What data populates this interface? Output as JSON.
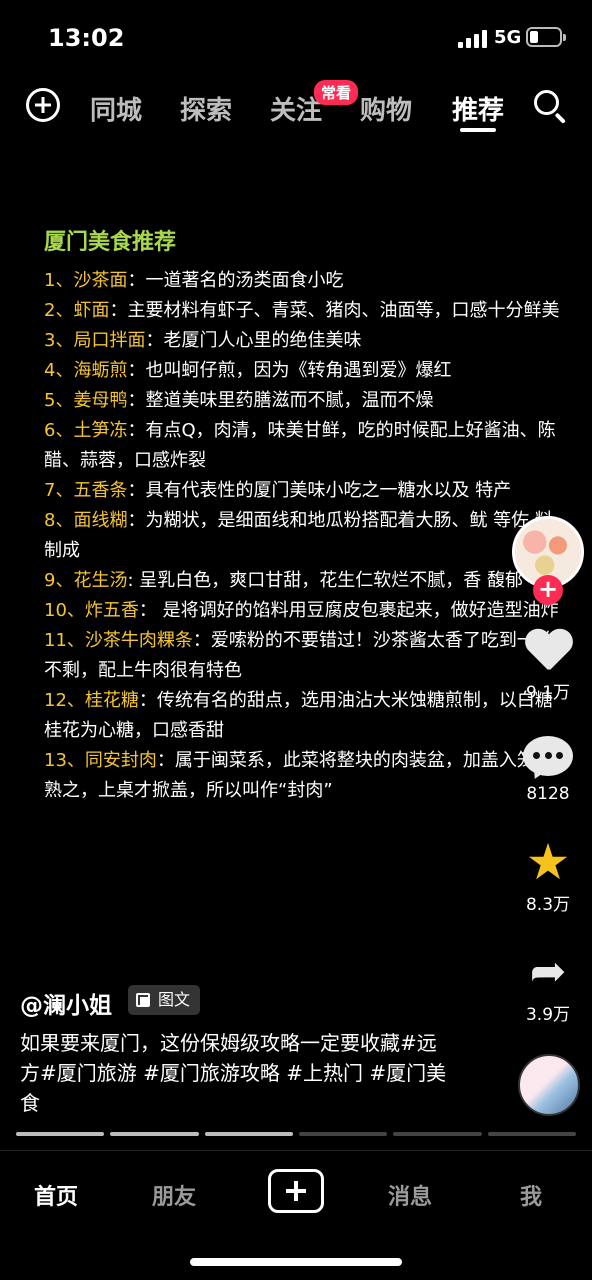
{
  "status_bar": {
    "time": "13:02",
    "network": "5G"
  },
  "top_nav": {
    "tabs": [
      "同城",
      "探索",
      "关注",
      "购物",
      "推荐"
    ],
    "badge": "常看",
    "active_tab": "推荐"
  },
  "post": {
    "title": "厦门美食推荐",
    "items": [
      {
        "num": "1、",
        "name": "沙茶面",
        "text": "：一道著名的汤类面食小吃"
      },
      {
        "num": "2、",
        "name": "虾面",
        "text": "：主要材料有虾子、青菜、猪肉、油面等，口感十分鲜美"
      },
      {
        "num": "3、",
        "name": "局口拌面",
        "text": "：老厦门人心里的绝佳美味"
      },
      {
        "num": "4、",
        "name": "海蛎煎",
        "text": "：也叫蚵仔煎，因为《转角遇到爱》爆红"
      },
      {
        "num": "5、",
        "name": "姜母鸭",
        "text": "：整道美味里药膳滋而不腻，温而不燥"
      },
      {
        "num": "6、",
        "name": "土笋冻",
        "text": "：有点Q，肉清，味美甘鲜，吃的时候配上好酱油、陈醋、蒜蓉，口感炸裂"
      },
      {
        "num": "7、",
        "name": "五香条",
        "text": "：具有代表性的厦门美味小吃之一糖水以及 特产"
      },
      {
        "num": "8、",
        "name": "面线糊",
        "text": "：为糊状，是细面线和地瓜粉搭配着大肠、鱿 等佐  料制成"
      },
      {
        "num": "9、",
        "name": "花生汤",
        "text": ": 呈乳白色，爽口甘甜，花生仁软烂不腻，香 馥郁"
      },
      {
        "num": "10、",
        "name": "炸五香",
        "text": "：  是将调好的馅料用豆腐皮包裹起来，做好造型油炸"
      },
      {
        "num": "11、",
        "name": "沙茶牛肉粿条",
        "text": "：爱嗦粉的不要错过！沙茶酱太香了吃到一丝不剩，配上牛肉很有特色"
      },
      {
        "num": "12、",
        "name": "桂花糖",
        "text": "：传统有名的甜点，选用油沾大米蚀糖煎制，以白糖桂花为心糖，口感香甜"
      },
      {
        "num": "13、",
        "name": "同安封肉",
        "text": "：属于闽菜系，此菜将整块的肉装盆，加盖入笼蒸熟之，上桌才掀盖，所以叫作“封肉”"
      }
    ]
  },
  "actions": {
    "likes": "9.1万",
    "comments": "8128",
    "favorites": "8.3万",
    "shares": "3.9万"
  },
  "author": {
    "name": "@澜小姐",
    "type_badge": "图文"
  },
  "caption": "如果要来厦门，这份保姆级攻略一定要收藏#远方#厦门旅游 #厦门旅游攻略 #上热门 #厦门美食",
  "progress": {
    "total_pages": 6,
    "viewed_pages": 3
  },
  "bottom_nav": {
    "home": "首页",
    "friends": "朋友",
    "messages": "消息",
    "me": "我"
  },
  "colors": {
    "accent_red": "#fe2c55",
    "title_green": "#a8d94a",
    "item_yellow": "#f5c431",
    "star_gold": "#f6c21c"
  }
}
